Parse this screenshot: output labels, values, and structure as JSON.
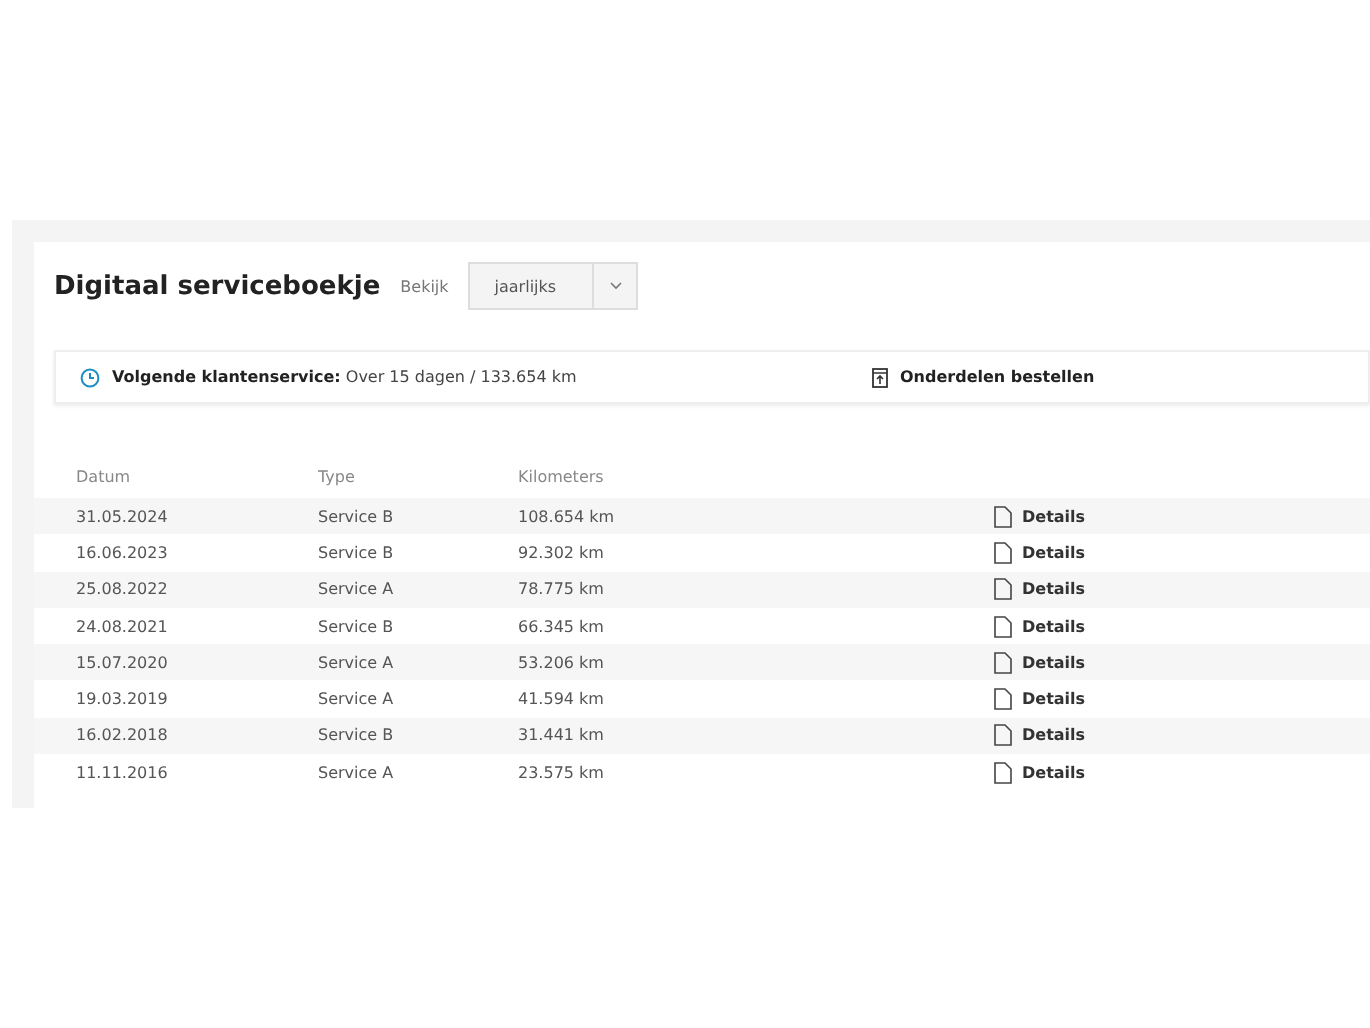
{
  "title": "Digitaal serviceboekje",
  "view": {
    "label": "Bekijk",
    "value": "jaarlijks"
  },
  "next_service": {
    "label": "Volgende klantenservice:",
    "value": "Over 15 dagen / 133.654 km"
  },
  "order_parts": "Onderdelen bestellen",
  "table": {
    "columns": [
      "Datum",
      "Type",
      "Kilometers"
    ],
    "rows": [
      {
        "date": "31.05.2024",
        "type": "Service B",
        "km": "108.654 km",
        "action": "Details"
      },
      {
        "date": "16.06.2023",
        "type": "Service B",
        "km": "92.302 km",
        "action": "Details"
      },
      {
        "date": "25.08.2022",
        "type": "Service A",
        "km": "78.775 km",
        "action": "Details"
      },
      {
        "date": "24.08.2021",
        "type": "Service B",
        "km": "66.345 km",
        "action": "Details"
      },
      {
        "date": "15.07.2020",
        "type": "Service A",
        "km": "53.206 km",
        "action": "Details"
      },
      {
        "date": "19.03.2019",
        "type": "Service A",
        "km": "41.594 km",
        "action": "Details"
      },
      {
        "date": "16.02.2018",
        "type": "Service B",
        "km": "31.441 km",
        "action": "Details"
      },
      {
        "date": "11.11.2016",
        "type": "Service A",
        "km": "23.575 km",
        "action": "Details"
      }
    ]
  }
}
